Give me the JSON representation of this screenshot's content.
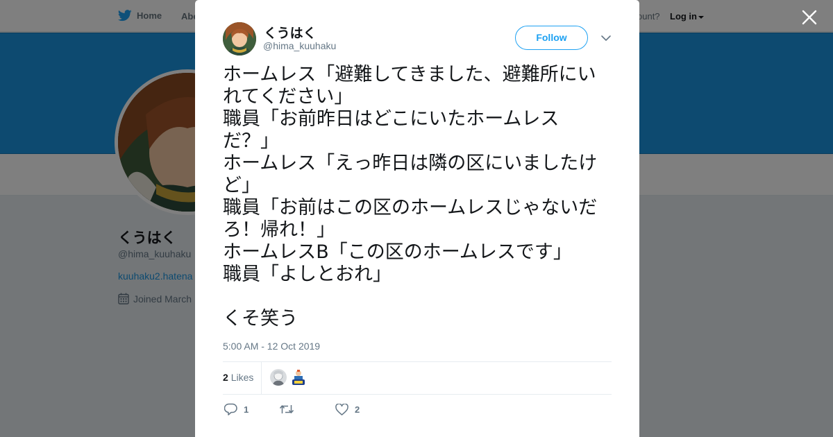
{
  "nav": {
    "home": "Home",
    "about": "Abo",
    "account_prompt": "ccount?",
    "login": "Log in"
  },
  "profile": {
    "name": "くうはく",
    "handle": "@hima_kuuhaku",
    "link": "kuuhaku2.hatena",
    "joined": "Joined March"
  },
  "tweet": {
    "author_name": "くうはく",
    "author_handle": "@hima_kuuhaku",
    "follow_label": "Follow",
    "lines": [
      "ホームレス「避難してきました、避難所にい",
      "れてください」",
      "職員「お前昨日はどこにいたホームレス",
      "だ？」",
      "ホームレス「えっ昨日は隣の区にいましたけ",
      "ど」",
      "職員「お前はこの区のホームレスじゃないだ",
      "ろ！帰れ！」",
      "ホームレスB「この区のホームレスです」",
      "職員「よしとおれ」",
      "",
      "くそ笑う"
    ],
    "timestamp": "5:00 AM - 12 Oct 2019",
    "likes_count": "2",
    "likes_label": "Likes",
    "reply_count": "1",
    "retweet_count": "",
    "like_count": "2"
  },
  "colors": {
    "accent": "#1da1f2",
    "banner": "#1b95e0",
    "overlay": "rgba(0,0,0,0.5)"
  },
  "icons": [
    "twitter-bird-icon",
    "close-icon",
    "chevron-down-icon",
    "reply-icon",
    "retweet-icon",
    "heart-icon",
    "calendar-icon"
  ]
}
